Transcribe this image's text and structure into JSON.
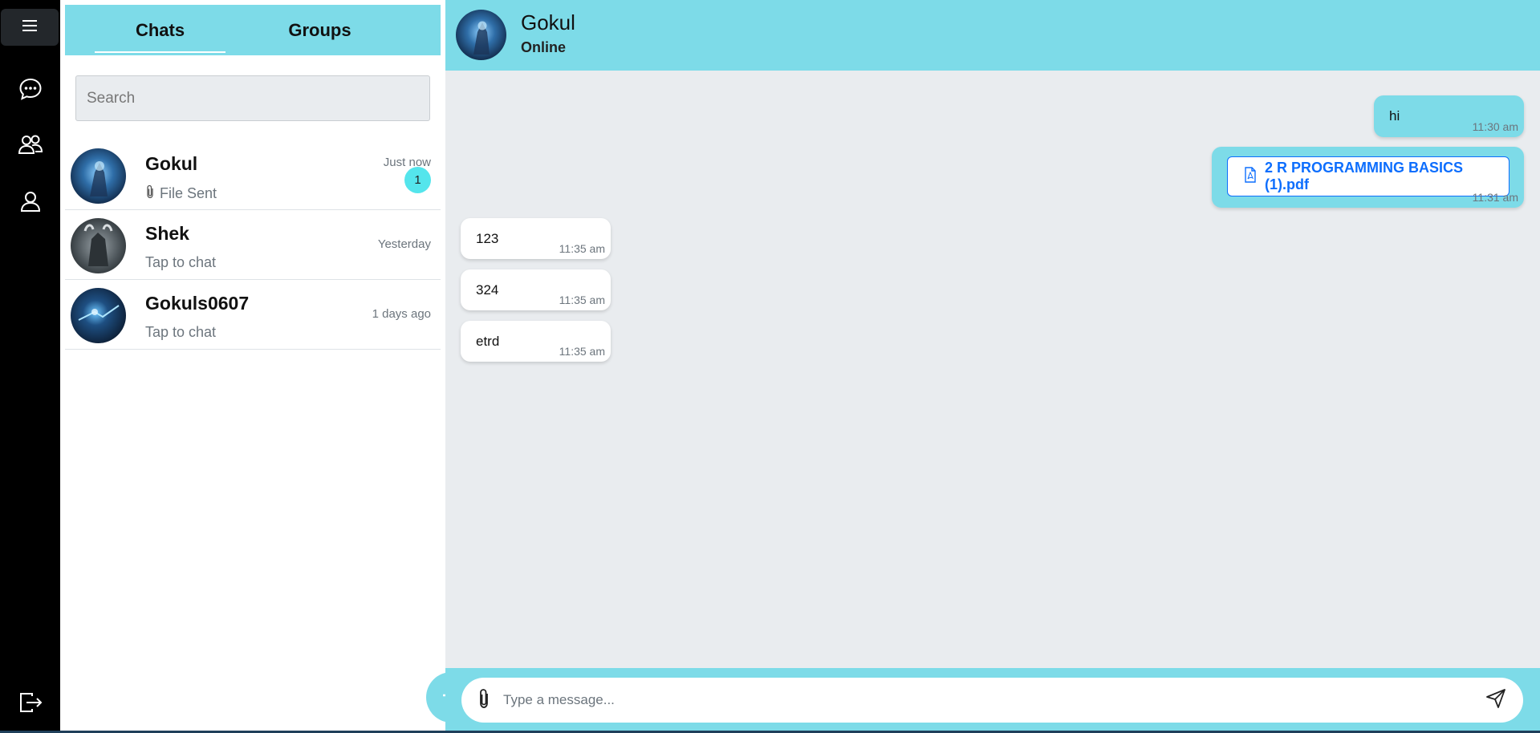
{
  "sidebar": {
    "menu_icon": "hamburger-icon",
    "items": [
      {
        "icon": "chat-bubble-icon"
      },
      {
        "icon": "people-icon"
      },
      {
        "icon": "person-icon"
      }
    ],
    "logout_icon": "logout-icon"
  },
  "tabs": {
    "chats": "Chats",
    "groups": "Groups"
  },
  "search": {
    "placeholder": "Search"
  },
  "contacts": [
    {
      "name": "Gokul",
      "subtitle": "File Sent",
      "time": "Just now",
      "unread": "1",
      "has_file_icon": true
    },
    {
      "name": "Shek",
      "subtitle": "Tap to chat",
      "time": "Yesterday"
    },
    {
      "name": "Gokuls0607",
      "subtitle": "Tap to chat",
      "time": "1 days ago"
    }
  ],
  "conversation": {
    "name": "Gokul",
    "status": "Online",
    "messages": [
      {
        "direction": "out",
        "text": "hi",
        "time": "11:30 am"
      },
      {
        "direction": "out",
        "file": "2 R PROGRAMMING BASICS (1).pdf",
        "time": "11:31 am"
      },
      {
        "direction": "in",
        "text": "123",
        "time": "11:35 am"
      },
      {
        "direction": "in",
        "text": "324",
        "time": "11:35 am"
      },
      {
        "direction": "in",
        "text": "etrd",
        "time": "11:35 am"
      }
    ]
  },
  "composer": {
    "placeholder": "Type a message..."
  },
  "colors": {
    "accent": "#7ddbe8",
    "rail": "#000000",
    "badge": "#54e5ec",
    "link": "#0d6efd"
  }
}
